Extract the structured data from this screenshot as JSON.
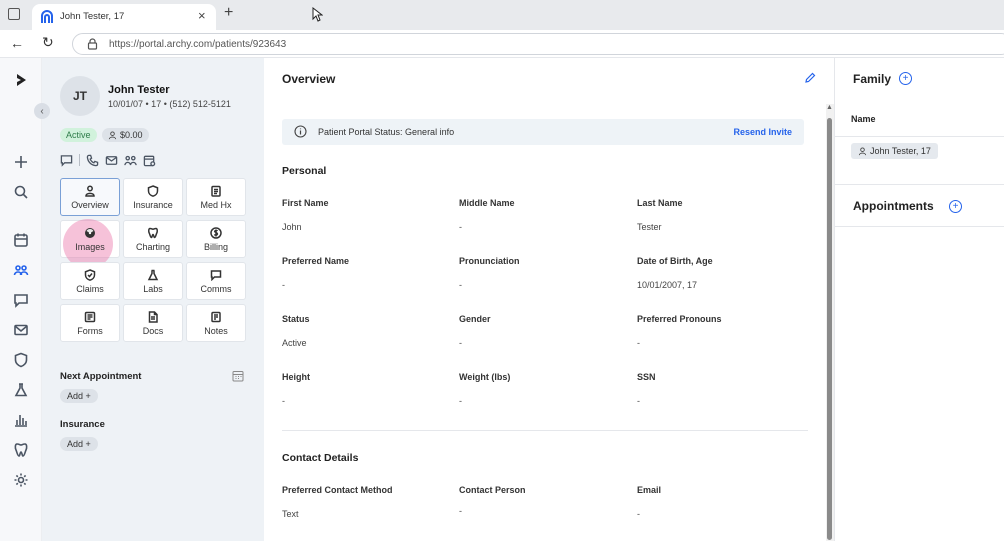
{
  "browser": {
    "tab_title": "John Tester, 17",
    "url": "https://portal.archy.com/patients/923643"
  },
  "patient": {
    "initials": "JT",
    "name": "John Tester",
    "summary": "10/01/07 • 17 • (512) 512-5121",
    "status": "Active",
    "balance": "$0.00"
  },
  "tiles": [
    {
      "label": "Overview",
      "icon": "person-icon"
    },
    {
      "label": "Insurance",
      "icon": "shield-icon"
    },
    {
      "label": "Med Hx",
      "icon": "clipboard-icon"
    },
    {
      "label": "Images",
      "icon": "radiation-icon"
    },
    {
      "label": "Charting",
      "icon": "tooth-icon"
    },
    {
      "label": "Billing",
      "icon": "dollar-icon"
    },
    {
      "label": "Claims",
      "icon": "shield-check-icon"
    },
    {
      "label": "Labs",
      "icon": "flask-icon"
    },
    {
      "label": "Comms",
      "icon": "chat-icon"
    },
    {
      "label": "Forms",
      "icon": "form-icon"
    },
    {
      "label": "Docs",
      "icon": "document-icon"
    },
    {
      "label": "Notes",
      "icon": "note-icon"
    }
  ],
  "next_appointment": {
    "label": "Next Appointment",
    "add": "Add"
  },
  "insurance": {
    "label": "Insurance",
    "add": "Add"
  },
  "overview": {
    "title": "Overview",
    "notice": {
      "text": "Patient Portal Status: General info",
      "link": "Resend Invite"
    },
    "personal_title": "Personal",
    "fields": {
      "first_name": {
        "label": "First Name",
        "value": "John"
      },
      "middle_name": {
        "label": "Middle Name",
        "value": "-"
      },
      "last_name": {
        "label": "Last Name",
        "value": "Tester"
      },
      "preferred_name": {
        "label": "Preferred Name",
        "value": "-"
      },
      "pronunciation": {
        "label": "Pronunciation",
        "value": "-"
      },
      "dob_age": {
        "label": "Date of Birth, Age",
        "value": "10/01/2007, 17"
      },
      "status": {
        "label": "Status",
        "value": "Active"
      },
      "gender": {
        "label": "Gender",
        "value": "-"
      },
      "pronouns": {
        "label": "Preferred Pronouns",
        "value": "-"
      },
      "height": {
        "label": "Height",
        "value": "-"
      },
      "weight": {
        "label": "Weight (lbs)",
        "value": "-"
      },
      "ssn": {
        "label": "SSN",
        "value": "-"
      }
    },
    "contact_title": "Contact Details",
    "contact": {
      "method": {
        "label": "Preferred Contact Method",
        "value": "Text"
      },
      "person": {
        "label": "Contact Person",
        "value": "-"
      },
      "email": {
        "label": "Email",
        "value": "-"
      }
    }
  },
  "family": {
    "title": "Family",
    "column": "Name",
    "member": "John Tester, 17",
    "appointments_title": "Appointments"
  }
}
